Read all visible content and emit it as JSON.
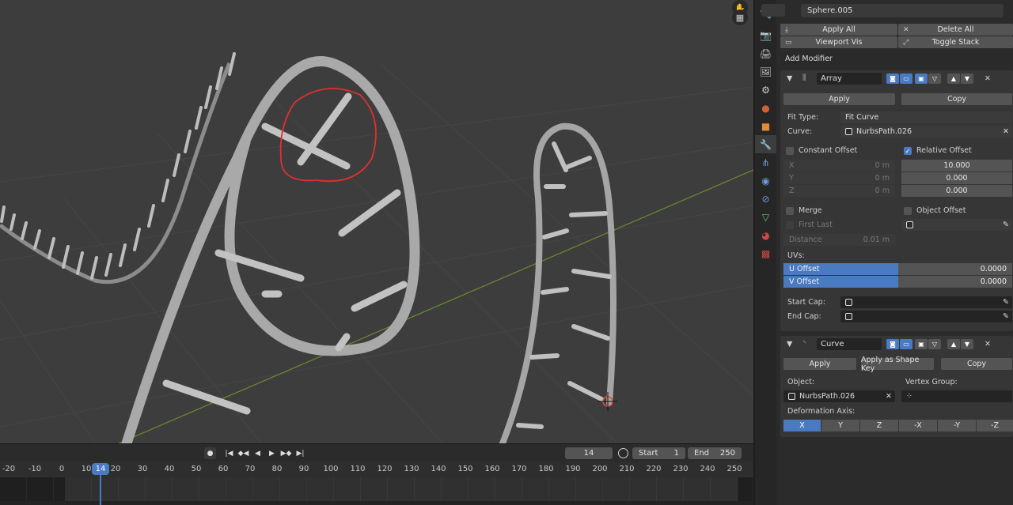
{
  "colors": {
    "accent": "#4a7ac2",
    "viewport_bg": "#3d3d3d",
    "annotation": "#e03030"
  },
  "viewport": {
    "gizmo_top_icon": "hand-icon",
    "gizmo_bottom_icon": "grid-icon"
  },
  "timeline": {
    "current_frame": "14",
    "start_label": "Start",
    "start_value": "1",
    "end_label": "End",
    "end_value": "250",
    "ticks": [
      "-20",
      "-10",
      "0",
      "10",
      "14",
      "20",
      "30",
      "40",
      "50",
      "60",
      "70",
      "80",
      "90",
      "100",
      "110",
      "120",
      "130",
      "140",
      "150",
      "160",
      "170",
      "180",
      "190",
      "200",
      "210",
      "220",
      "230",
      "240",
      "250"
    ],
    "transport_icons": [
      "record-icon",
      "jump-start-icon",
      "prev-keyframe-icon",
      "play-reverse-icon",
      "play-icon",
      "next-keyframe-icon",
      "jump-end-icon"
    ]
  },
  "properties": {
    "object_name": "Sphere.005",
    "apply_all": "Apply All",
    "delete_all": "Delete All",
    "viewport_vis": "Viewport Vis",
    "toggle_stack": "Toggle Stack",
    "add_modifier": "Add Modifier",
    "array": {
      "name": "Array",
      "apply": "Apply",
      "copy": "Copy",
      "fit_type_label": "Fit Type:",
      "fit_type_value": "Fit Curve",
      "curve_label": "Curve:",
      "curve_value": "NurbsPath.026",
      "constant_offset": "Constant Offset",
      "relative_offset": "Relative Offset",
      "const_x": "X",
      "const_y": "Y",
      "const_z": "Z",
      "const_val": "0 m",
      "rel_x": "10.000",
      "rel_y": "0.000",
      "rel_z": "0.000",
      "merge": "Merge",
      "object_offset": "Object Offset",
      "first_last": "First Last",
      "distance_label": "Distance",
      "distance_value": "0.01 m",
      "uvs_label": "UVs:",
      "u_offset_label": "U Offset",
      "u_offset_value": "0.0000",
      "v_offset_label": "V Offset",
      "v_offset_value": "0.0000",
      "start_cap": "Start Cap:",
      "end_cap": "End Cap:"
    },
    "curve": {
      "name": "Curve",
      "apply": "Apply",
      "apply_shape_key": "Apply as Shape Key",
      "copy": "Copy",
      "object_label": "Object:",
      "object_value": "NurbsPath.026",
      "vertex_group_label": "Vertex Group:",
      "deformation_axis_label": "Deformation Axis:",
      "axes": [
        "X",
        "Y",
        "Z",
        "-X",
        "-Y",
        "-Z"
      ],
      "active_axis": "X"
    },
    "tabs": [
      "tool-icon",
      "render-icon",
      "output-icon",
      "view-layer-icon",
      "scene-icon",
      "world-icon",
      "object-icon",
      "modifier-icon",
      "particles-icon",
      "physics-icon",
      "constraints-icon",
      "data-icon",
      "material-icon",
      "texture-icon"
    ]
  }
}
